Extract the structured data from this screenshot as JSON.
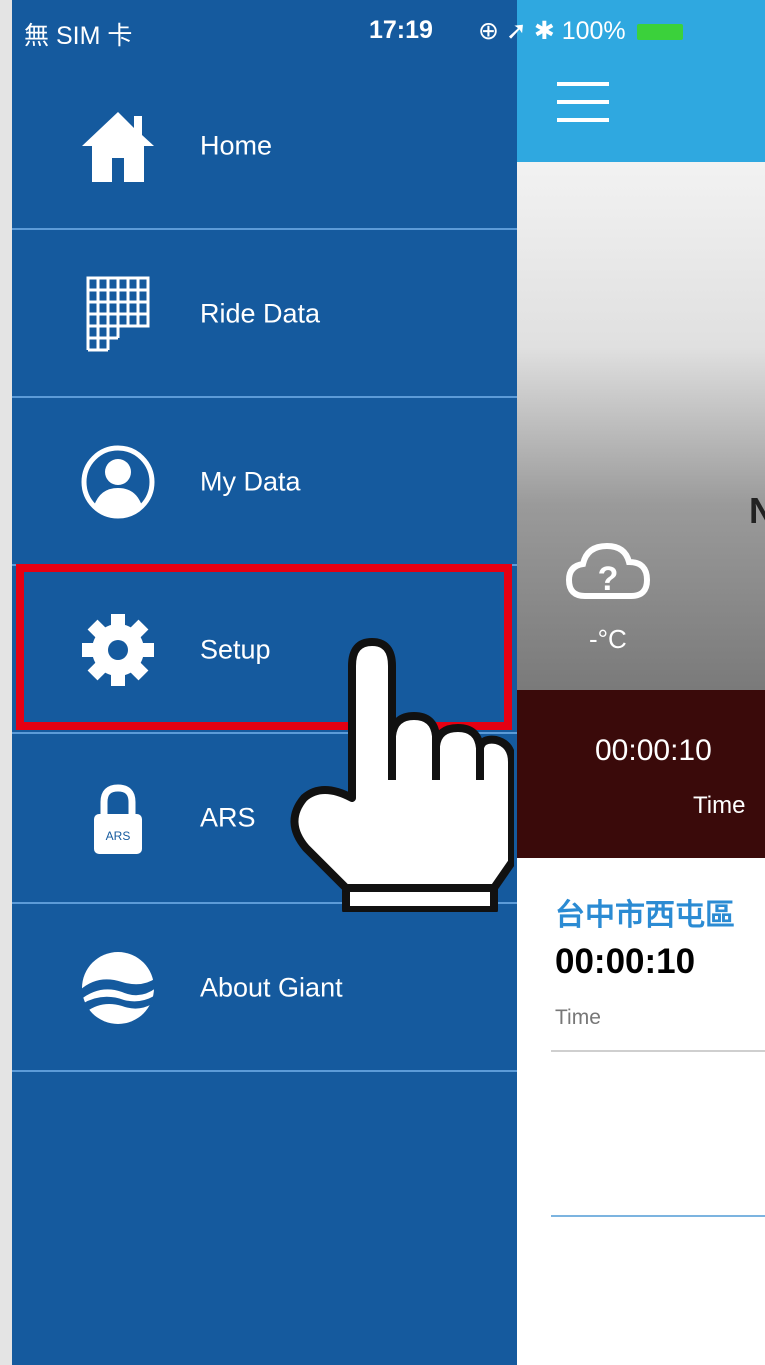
{
  "status_bar": {
    "carrier": "無 SIM 卡",
    "time": "17:19",
    "battery": "100%",
    "battery_color": "#3bd13b"
  },
  "menu": {
    "background_color": "#155a9e",
    "items": [
      {
        "label": "Home",
        "icon": "home-icon"
      },
      {
        "label": "Ride Data",
        "icon": "grid-icon"
      },
      {
        "label": "My Data",
        "icon": "user-icon"
      },
      {
        "label": "Setup",
        "icon": "gear-icon"
      },
      {
        "label": "ARS",
        "icon": "lock-icon",
        "icon_text": "ARS"
      },
      {
        "label": "About Giant",
        "icon": "giant-logo-icon"
      }
    ],
    "highlighted_item": "Setup",
    "highlight_color": "#e60012"
  },
  "main": {
    "topbar_color": "#2fa8e0",
    "partial_letter": "N",
    "weather": {
      "icon": "cloud-unknown-icon",
      "temperature": "-°C"
    },
    "stats": {
      "time_value": "00:00:10",
      "time_label": "Time"
    },
    "location": {
      "name": "台中市西屯區",
      "time_value": "00:00:10",
      "time_label": "Time"
    }
  }
}
